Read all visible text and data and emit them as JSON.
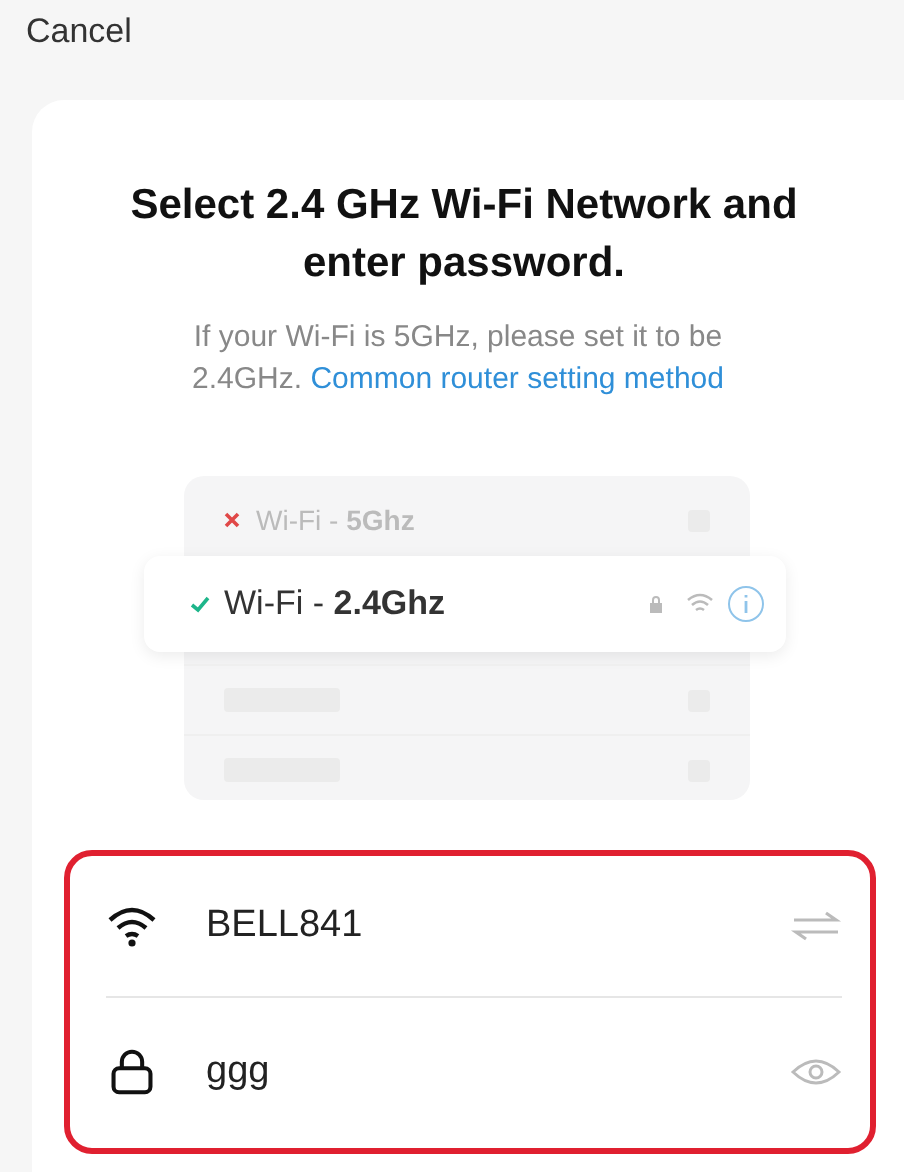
{
  "cancel": "Cancel",
  "title": "Select 2.4 GHz Wi-Fi Network and enter password.",
  "hint": {
    "text": "If your Wi-Fi is 5GHz, please set it to be 2.4GHz.",
    "link": "Common router setting method"
  },
  "illustration": {
    "networks": [
      {
        "label": "Wi-Fi - **5Ghz**",
        "selected": false
      },
      {
        "label": "Wi-Fi - **2.4Ghz**",
        "selected": true
      }
    ]
  },
  "fields": [
    {
      "kind": "network",
      "value": "BELL841"
    },
    {
      "kind": "password",
      "value": "ggg"
    }
  ]
}
